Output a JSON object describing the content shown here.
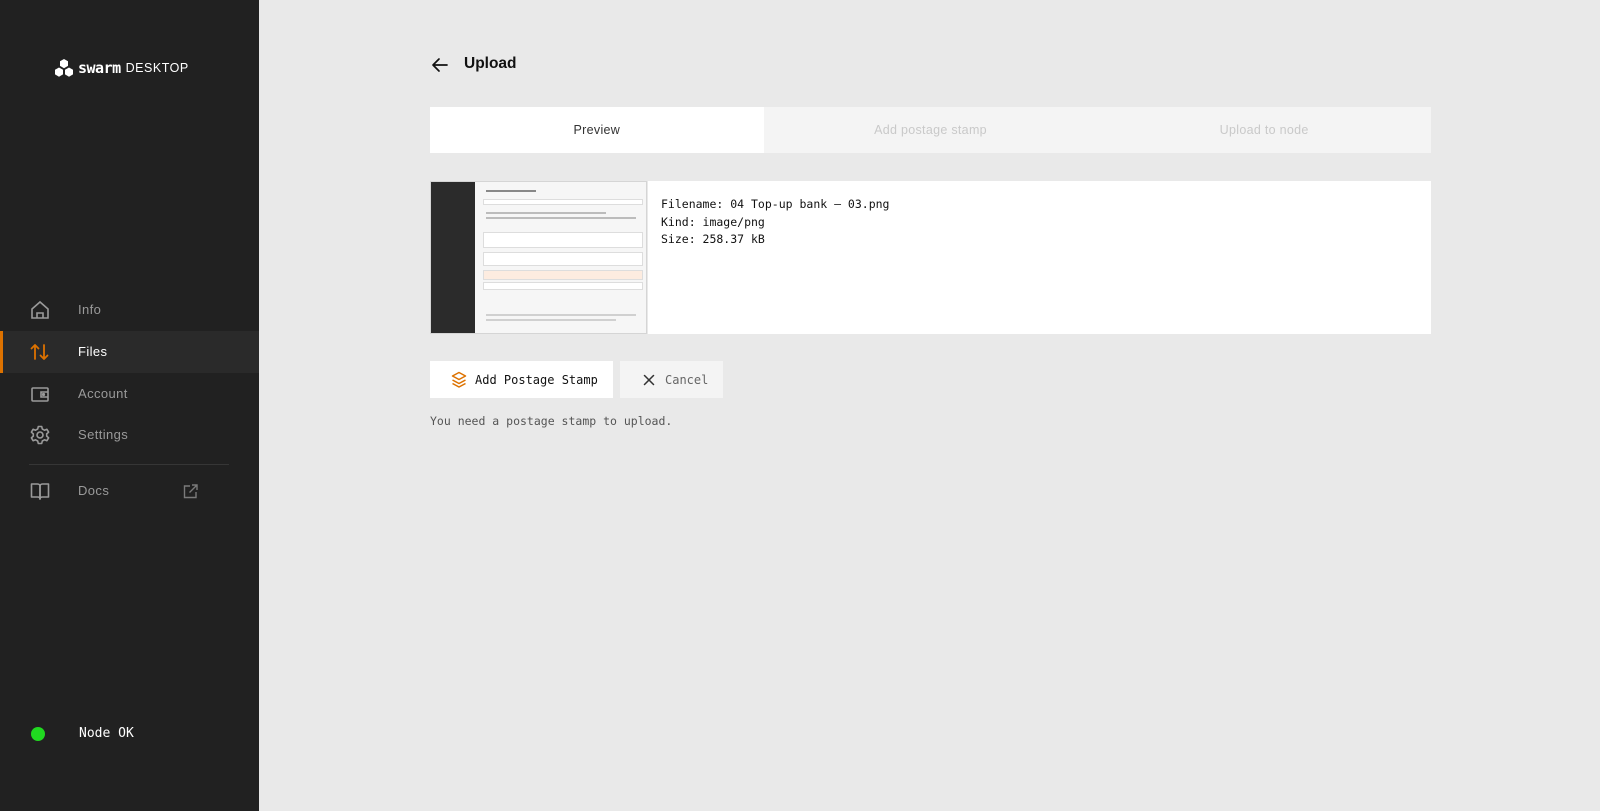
{
  "app": {
    "brand": "swarm",
    "brand_suffix": "DESKTOP"
  },
  "sidebar": {
    "items": [
      {
        "label": "Info",
        "icon": "home-icon"
      },
      {
        "label": "Files",
        "icon": "transfer-arrows-icon",
        "active": true
      },
      {
        "label": "Account",
        "icon": "wallet-icon"
      },
      {
        "label": "Settings",
        "icon": "gear-icon"
      },
      {
        "label": "Docs",
        "icon": "book-icon",
        "external": true
      }
    ],
    "status": {
      "label": "Node OK",
      "color": "#20d920"
    }
  },
  "colors": {
    "accent": "#dd7200",
    "sidebar_bg": "#212121",
    "main_bg": "#e9e9e9"
  },
  "page": {
    "title": "Upload"
  },
  "steps": [
    {
      "label": "Preview",
      "active": true
    },
    {
      "label": "Add postage stamp",
      "active": false
    },
    {
      "label": "Upload to node",
      "active": false
    }
  ],
  "file": {
    "filename": "Filename: 04 Top-up bank — 03.png",
    "kind": "Kind: image/png",
    "size": "Size: 258.37 kB"
  },
  "actions": {
    "add_stamp": "Add Postage Stamp",
    "cancel": "Cancel"
  },
  "note": "You need a postage stamp to upload."
}
